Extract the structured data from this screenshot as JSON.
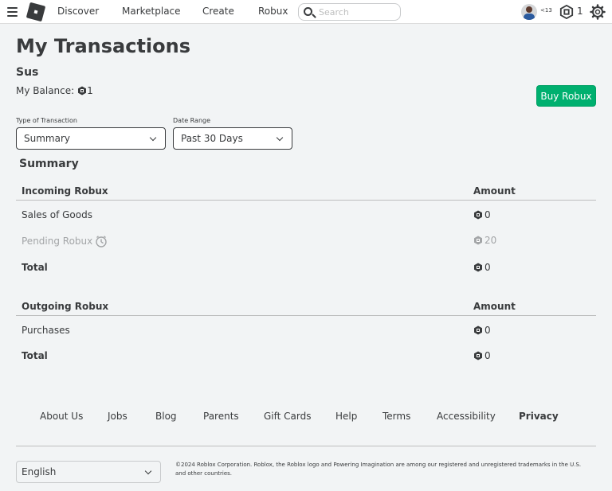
{
  "nav": {
    "links": [
      "Discover",
      "Marketplace",
      "Create",
      "Robux"
    ],
    "search_placeholder": "Search",
    "age_label": "<13",
    "robux_count": "1"
  },
  "page": {
    "title": "My Transactions",
    "username": "Sus",
    "balance_label": "My Balance:",
    "balance_value": "1",
    "buy_button": "Buy Robux"
  },
  "filters": {
    "type_label": "Type of Transaction",
    "type_value": "Summary",
    "date_label": "Date Range",
    "date_value": "Past 30 Days"
  },
  "summary": {
    "title": "Summary",
    "incoming": {
      "header": "Incoming Robux",
      "amount_header": "Amount",
      "rows": [
        {
          "label": "Sales of Goods",
          "amount": "0"
        },
        {
          "label": "Pending Robux",
          "amount": "20"
        },
        {
          "label": "Total",
          "amount": "0"
        }
      ]
    },
    "outgoing": {
      "header": "Outgoing Robux",
      "amount_header": "Amount",
      "rows": [
        {
          "label": "Purchases",
          "amount": "0"
        },
        {
          "label": "Total",
          "amount": "0"
        }
      ]
    }
  },
  "footer": {
    "links": [
      "About Us",
      "Jobs",
      "Blog",
      "Parents",
      "Gift Cards",
      "Help",
      "Terms",
      "Accessibility",
      "Privacy"
    ],
    "language": "English",
    "copyright": "©2024 Roblox Corporation. Roblox, the Roblox logo and Powering Imagination are among our registered and unregistered trademarks in the U.S. and other countries."
  },
  "colors": {
    "accent_green": "#00b06f",
    "text": "#393b3d",
    "muted": "#a3a5a7"
  },
  "icons": {
    "menu": "hamburger-icon",
    "logo": "roblox-logo-icon",
    "search": "search-icon",
    "robux": "robux-icon",
    "settings": "gear-icon",
    "pending": "clock-icon"
  }
}
